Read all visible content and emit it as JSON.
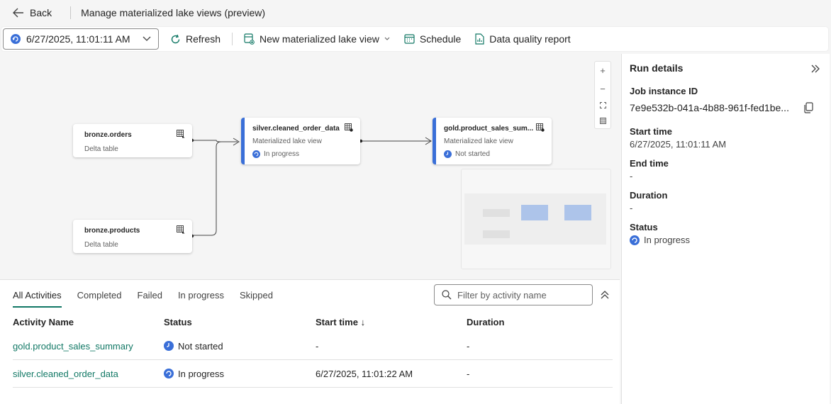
{
  "header": {
    "back_label": "Back",
    "title": "Manage materialized lake views (preview)"
  },
  "toolbar": {
    "run_date": "6/27/2025, 11:01:11 AM",
    "refresh_label": "Refresh",
    "new_mlv_label": "New materialized lake view",
    "schedule_label": "Schedule",
    "dq_report_label": "Data quality report"
  },
  "lineage": {
    "nodes": [
      {
        "name": "bronze.orders",
        "type": "Delta table"
      },
      {
        "name": "bronze.products",
        "type": "Delta table"
      },
      {
        "name": "silver.cleaned_order_data",
        "type": "Materialized lake view",
        "status": "In progress"
      },
      {
        "name": "gold.product_sales_sum...",
        "type": "Materialized lake view",
        "status": "Not started"
      }
    ],
    "zoom_in": "+",
    "zoom_out": "−"
  },
  "activities": {
    "tabs": [
      "All Activities",
      "Completed",
      "Failed",
      "In progress",
      "Skipped"
    ],
    "filter_placeholder": "Filter by activity name",
    "columns": [
      "Activity Name",
      "Status",
      "Start time ↓",
      "Duration"
    ],
    "rows": [
      {
        "name": "gold.product_sales_summary",
        "status": "Not started",
        "start": "-",
        "duration": "-"
      },
      {
        "name": "silver.cleaned_order_data",
        "status": "In progress",
        "start": "6/27/2025, 11:01:22 AM",
        "duration": "-"
      }
    ]
  },
  "run_details": {
    "title": "Run details",
    "job_label": "Job instance ID",
    "job_id": "7e9e532b-041a-4b88-961f-fed1be...",
    "start_label": "Start time",
    "start_value": "6/27/2025, 11:01:11 AM",
    "end_label": "End time",
    "end_value": "-",
    "duration_label": "Duration",
    "duration_value": "-",
    "status_label": "Status",
    "status_value": "In progress"
  },
  "colors": {
    "accent": "#117865",
    "mlv_bar": "#3a6fd8",
    "status_blue": "#3a6fd8"
  }
}
